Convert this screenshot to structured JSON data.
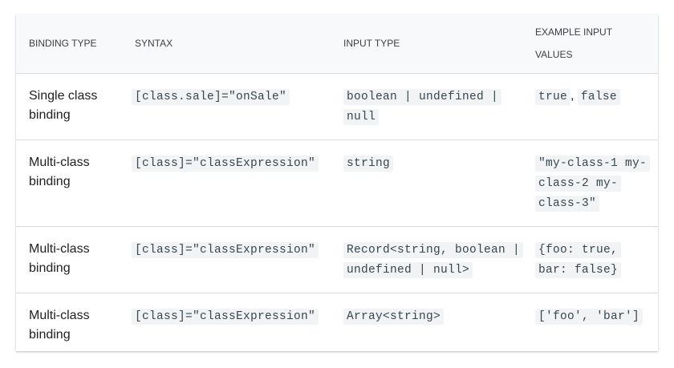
{
  "headers": {
    "binding_type": "BINDING TYPE",
    "syntax": "SYNTAX",
    "input_type": "INPUT TYPE",
    "example_values": "EXAMPLE INPUT VALUES"
  },
  "rows": [
    {
      "binding_type": "Single class binding",
      "syntax": "[class.sale]=\"onSale\"",
      "input_type": "boolean | undefined | null",
      "examples": [
        "true",
        "false"
      ]
    },
    {
      "binding_type": "Multi-class binding",
      "syntax": "[class]=\"classExpression\"",
      "input_type": "string",
      "examples": [
        "\"my-class-1 my-class-2 my-class-3\""
      ]
    },
    {
      "binding_type": "Multi-class binding",
      "syntax": "[class]=\"classExpression\"",
      "input_type": "Record<string, boolean | undefined | null>",
      "examples": [
        "{foo: true, bar: false}"
      ]
    },
    {
      "binding_type": "Multi-class binding",
      "syntax": "[class]=\"classExpression\"",
      "input_type": "Array<string>",
      "examples": [
        "['foo', 'bar']"
      ]
    }
  ],
  "separator": ", "
}
